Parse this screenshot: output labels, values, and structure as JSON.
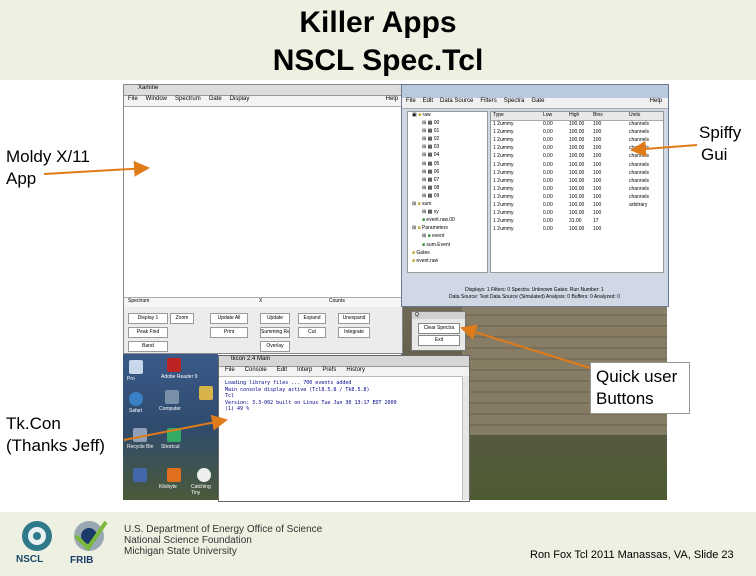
{
  "slide": {
    "title_line1": "Killer Apps",
    "title_line2": "NSCL Spec.Tcl",
    "note_moldy_line1": "Moldy X/11",
    "note_moldy_line2": "App",
    "note_spiffy_line1": "Spiffy",
    "note_spiffy_line2": "Gui",
    "note_quick_line1": "Quick user",
    "note_quick_line2": "Buttons",
    "note_tkcon_line1": "Tk.Con",
    "note_tkcon_line2": "(Thanks Jeff)",
    "credit": "Ron Fox Tcl 2011 Manassas, VA, Slide 23",
    "accent_color": "#e07b1a"
  },
  "logos": {
    "nscl": "NSCL",
    "frib": "FRIB",
    "org_line1": "U.S. Department of Energy Office of Science",
    "org_line2": "National Science Foundation",
    "org_line3": "Michigan State University"
  },
  "xamine": {
    "title": "Xamine",
    "menus": [
      "File",
      "Window",
      "Spectrum",
      "Gate",
      "Display",
      "Help"
    ],
    "status_left": "Spectrum",
    "status_mid": "X",
    "status_right": "Counts",
    "buttons": [
      "Display 1",
      "Zoom",
      "Update All",
      "Update",
      "Expand",
      "Unexpand",
      "Peak Find",
      "Print",
      "Summing Region",
      "Cut",
      "Integrate",
      "Band",
      "Overlay"
    ]
  },
  "spectcl": {
    "menus": [
      "File",
      "Edit",
      "Data Source",
      "Filters",
      "Spectra",
      "Gate",
      "Help"
    ],
    "tree_root": "raw",
    "tree_items": [
      "00",
      "01",
      "02",
      "03",
      "04",
      "05",
      "06",
      "07",
      "08",
      "09"
    ],
    "tree_groups": [
      "sum",
      "xy",
      "event.raw.00",
      "Parameters",
      "event",
      "sum.Event",
      "Gates",
      "event.raw"
    ],
    "columns": [
      "Type",
      "Low",
      "High",
      "Bins",
      "Units"
    ],
    "rows": [
      [
        "1 2ummy",
        "0.00",
        "100.00",
        "100",
        "channels"
      ],
      [
        "1 2ummy",
        "0.00",
        "100.00",
        "100",
        "channels"
      ],
      [
        "1 2ummy",
        "0.00",
        "100.00",
        "100",
        "channels"
      ],
      [
        "1 2ummy",
        "0.00",
        "100.00",
        "100",
        "channels"
      ],
      [
        "1 2ummy",
        "0.00",
        "100.00",
        "100",
        "channels"
      ],
      [
        "1 2ummy",
        "0.00",
        "100.00",
        "100",
        "channels"
      ],
      [
        "1 2ummy",
        "0.00",
        "100.00",
        "100",
        "channels"
      ],
      [
        "1 2ummy",
        "0.00",
        "100.00",
        "100",
        "channels"
      ],
      [
        "1 2ummy",
        "0.00",
        "100.00",
        "100",
        "channels"
      ],
      [
        "1 2ummy",
        "0.00",
        "100.00",
        "100",
        "channels"
      ],
      [
        "1 2ummy",
        "0.00",
        "100.00",
        "100",
        "arbitrary"
      ],
      [
        "1 2ummy",
        "0.00",
        "100.00",
        "100",
        ""
      ],
      [
        "1 2ummy",
        "0.00",
        "31.00",
        "17",
        ""
      ],
      [
        "1 2ummy",
        "0.00",
        "100.00",
        "100",
        ""
      ]
    ],
    "status_line1": "Displays: 1 Filters: 0 Spectra: Unknown Gates: Run Number: 1",
    "status_line2": "Data Source: Test Data Source (Simulated) Analysis: 0 Buffers: 0 Analyzed: 0"
  },
  "quick": {
    "title": "Q",
    "buttons": [
      "Clear Spectra",
      "Exit"
    ]
  },
  "tkcon": {
    "title": "tkcon 2.4 Main",
    "menus": [
      "File",
      "Console",
      "Edit",
      "Interp",
      "Prefs",
      "History"
    ],
    "lines": [
      "Loading library files ... 700 events added",
      "Main console display active (Tcl8.5.8 / Tk8.5.8)",
      "Tcl",
      "Version:  3.3-002 built on Linux Tue Jun 30 13:17 EDT 2009",
      "(1) 49 % "
    ]
  },
  "desktop": {
    "icons": [
      "Pro",
      "Adobe Reader 9",
      "Safari",
      "Computer",
      "Recycle Bin",
      "Shortcut",
      "Kilobyte",
      "Catching Tiny"
    ]
  }
}
